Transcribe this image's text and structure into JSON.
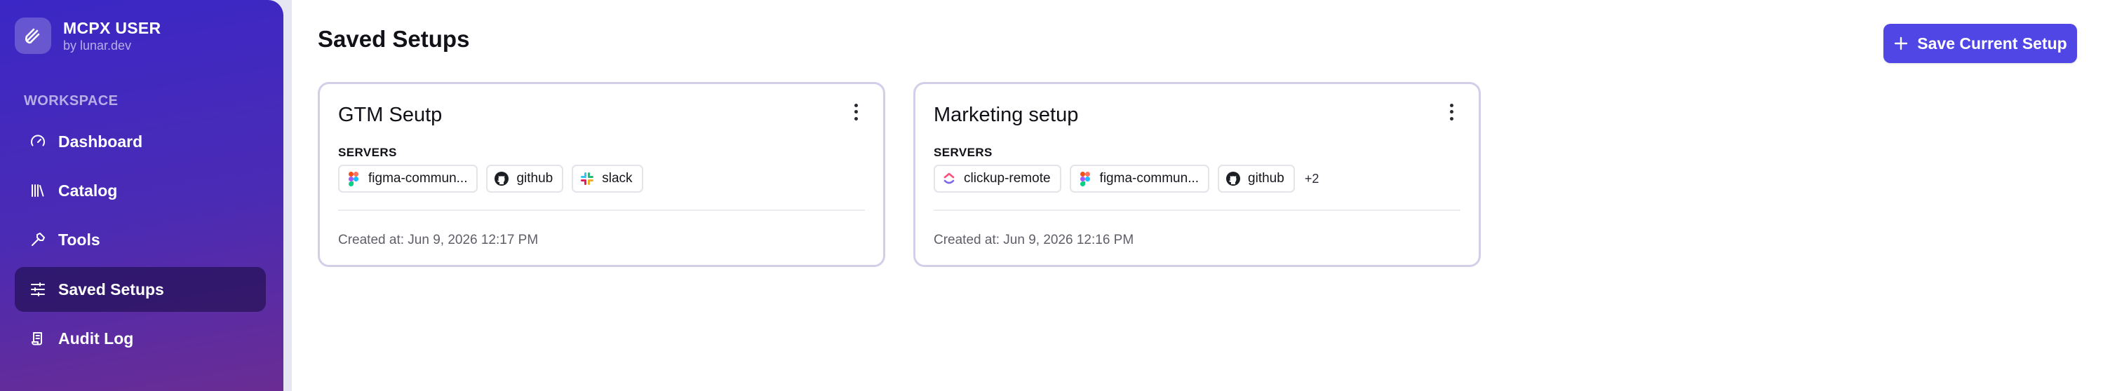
{
  "sidebar": {
    "brand": {
      "title": "MCPX USER",
      "subtitle": "by lunar.dev"
    },
    "section_label": "WORKSPACE",
    "items": [
      {
        "label": "Dashboard",
        "icon": "gauge-icon"
      },
      {
        "label": "Catalog",
        "icon": "library-icon"
      },
      {
        "label": "Tools",
        "icon": "hammer-icon"
      },
      {
        "label": "Saved Setups",
        "icon": "sliders-icon",
        "active": true
      },
      {
        "label": "Audit Log",
        "icon": "scroll-icon"
      }
    ]
  },
  "main": {
    "title": "Saved Setups",
    "save_button": "Save Current Setup",
    "cards": [
      {
        "title": "GTM Seutp",
        "servers_label": "SERVERS",
        "servers": [
          {
            "name": "figma-commun...",
            "icon": "figma-icon"
          },
          {
            "name": "github",
            "icon": "github-icon"
          },
          {
            "name": "slack",
            "icon": "slack-icon"
          }
        ],
        "more": "",
        "created": "Created at: Jun 9, 2026 12:17 PM"
      },
      {
        "title": "Marketing setup",
        "servers_label": "SERVERS",
        "servers": [
          {
            "name": "clickup-remote",
            "icon": "clickup-icon"
          },
          {
            "name": "figma-commun...",
            "icon": "figma-icon"
          },
          {
            "name": "github",
            "icon": "github-icon"
          }
        ],
        "more": "+2",
        "created": "Created at: Jun 9, 2026 12:16 PM"
      }
    ]
  },
  "colors": {
    "sidebar_start": "#3b27c6",
    "sidebar_end": "#6a2c93",
    "accent": "#4f46e5",
    "card_border": "#d2cfe9"
  }
}
